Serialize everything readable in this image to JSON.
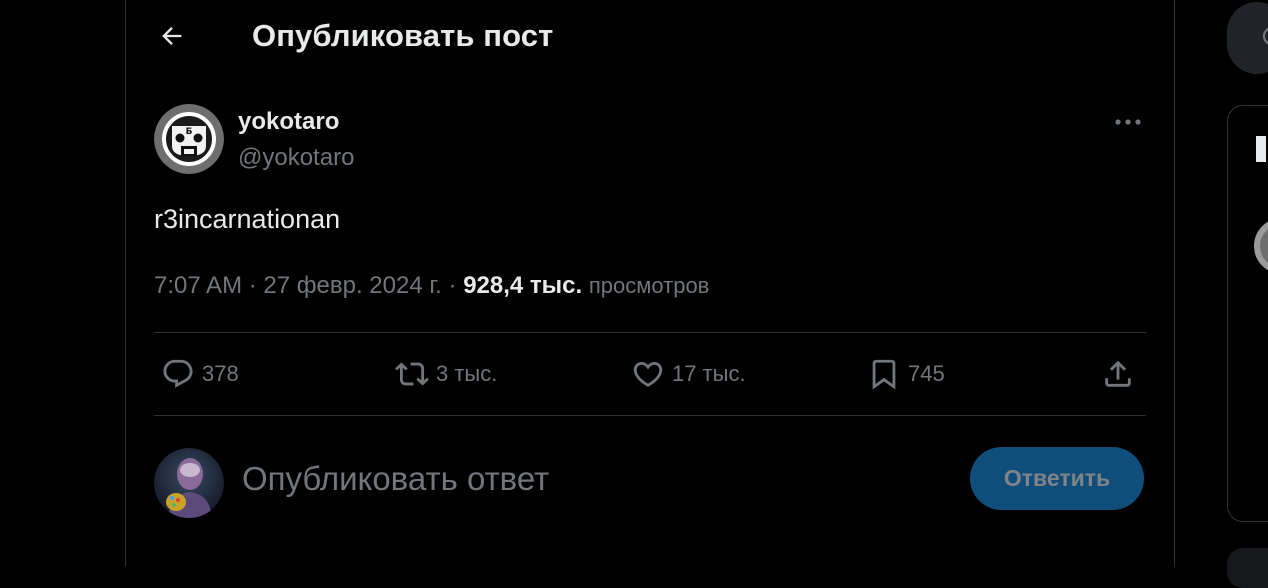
{
  "header": {
    "title": "Опубликовать пост"
  },
  "tweet": {
    "author_name": "yokotaro",
    "author_handle": "@yokotaro",
    "text": "r3incarnationan",
    "time": "7:07 AM",
    "date": "27 февр. 2024 г.",
    "views_count": "928,4 тыс.",
    "views_label": "просмотров"
  },
  "actions": {
    "replies": "378",
    "reposts": "3 тыс.",
    "likes": "17 тыс.",
    "bookmarks": "745"
  },
  "reply": {
    "placeholder": "Опубликовать ответ",
    "button_label": "Ответить"
  },
  "colors": {
    "background": "#000000",
    "text_primary": "#e7e9ea",
    "text_secondary": "#71767b",
    "divider": "#2f3336",
    "reply_button_bg": "#0f4e7a"
  }
}
